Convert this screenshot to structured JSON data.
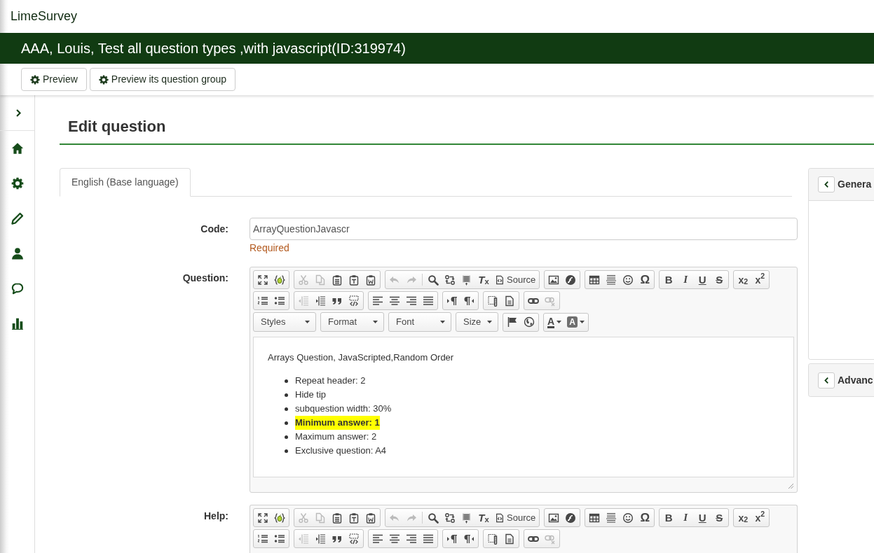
{
  "app": {
    "name": "LimeSurvey"
  },
  "survey": {
    "title": "AAA, Louis, Test all question types ,with javascript(ID:319974)"
  },
  "actions": [
    {
      "label": "Preview"
    },
    {
      "label": "Preview its question group"
    }
  ],
  "page": {
    "heading": "Edit question"
  },
  "language_tabs": [
    {
      "label": "English (Base language)",
      "selected": true
    }
  ],
  "fields": [
    {
      "kind": "text",
      "label": "Code:",
      "value": "ArrayQuestionJavascr",
      "note": "Required"
    },
    {
      "kind": "editor",
      "label": "Question:",
      "toolbar": [
        [
          [
            {
              "kind": "icon",
              "disabled": false
            },
            {
              "kind": "icon",
              "disabled": false
            }
          ],
          [
            {
              "kind": "icon",
              "disabled": true
            },
            {
              "kind": "icon",
              "disabled": true
            },
            {
              "kind": "icon",
              "disabled": false
            },
            {
              "kind": "icon",
              "disabled": false
            },
            {
              "kind": "icon",
              "disabled": false
            }
          ],
          [
            {
              "kind": "icon",
              "disabled": true
            },
            {
              "kind": "icon",
              "disabled": true
            },
            {
              "kind": "separator"
            },
            {
              "kind": "icon",
              "disabled": false
            },
            {
              "kind": "icon",
              "disabled": false
            },
            {
              "kind": "icon",
              "disabled": false
            },
            {
              "kind": "glyph",
              "label": "*T*$_{x}$",
              "disabled": false
            },
            {
              "kind": "labeled",
              "label": "Source",
              "disabled": false
            }
          ],
          [
            {
              "kind": "icon",
              "disabled": false
            },
            {
              "kind": "icon",
              "disabled": false
            }
          ],
          [
            {
              "kind": "icon",
              "disabled": false
            },
            {
              "kind": "icon",
              "disabled": false
            },
            {
              "kind": "icon",
              "disabled": false
            },
            {
              "kind": "glyph",
              "label": "Ω",
              "disabled": false
            }
          ],
          [
            {
              "kind": "bold",
              "label": "B",
              "disabled": false
            },
            {
              "kind": "italic",
              "label": "I",
              "disabled": false
            },
            {
              "kind": "underline",
              "label": "U",
              "disabled": false
            },
            {
              "kind": "strike",
              "label": "S",
              "disabled": false
            }
          ],
          [
            {
              "kind": "glyph",
              "label": "x$_{2}$",
              "disabled": false
            },
            {
              "kind": "glyph",
              "label": "x$^{2}$",
              "disabled": false
            }
          ]
        ],
        [
          [
            {
              "kind": "icon",
              "disabled": false
            },
            {
              "kind": "icon",
              "disabled": false
            }
          ],
          [
            {
              "kind": "icon",
              "disabled": true
            },
            {
              "kind": "icon",
              "disabled": false
            },
            {
              "kind": "icon",
              "disabled": false
            },
            {
              "kind": "icon",
              "disabled": false
            }
          ],
          [
            {
              "kind": "icon",
              "disabled": false
            },
            {
              "kind": "icon",
              "disabled": false
            },
            {
              "kind": "icon",
              "disabled": false
            },
            {
              "kind": "icon",
              "disabled": false
            }
          ],
          [
            {
              "kind": "icon",
              "disabled": false
            },
            {
              "kind": "icon",
              "disabled": false
            }
          ],
          [
            {
              "kind": "icon",
              "disabled": false
            },
            {
              "kind": "icon",
              "disabled": false
            }
          ],
          [
            {
              "kind": "icon",
              "disabled": false
            },
            {
              "kind": "icon",
              "disabled": true
            }
          ]
        ],
        [
          [
            {
              "kind": "combo",
              "label": "Styles"
            }
          ],
          [
            {
              "kind": "combo",
              "label": "Format"
            }
          ],
          [
            {
              "kind": "combo",
              "label": "Font"
            }
          ],
          [
            {
              "kind": "combo",
              "label": "Size"
            }
          ],
          [
            {
              "kind": "icon",
              "disabled": false
            },
            {
              "kind": "icon",
              "disabled": false
            }
          ],
          [
            {
              "kind": "text-color",
              "label": "A",
              "disabled": false
            },
            {
              "kind": "back-color",
              "label": "A",
              "disabled": false
            }
          ]
        ]
      ],
      "content": {
        "paragraph": "Arrays Question, JavaScripted,Random Order",
        "list": [
          {
            "text": "Repeat header: 2",
            "highlighted": false
          },
          {
            "text": "Hide tip",
            "highlighted": false
          },
          {
            "text": "subquestion width: 30%",
            "highlighted": false
          },
          {
            "text": "Minimum answer: 1",
            "highlighted": true
          },
          {
            "text": "Maximum answer: 2",
            "highlighted": false
          },
          {
            "text": "Exclusive question: A4",
            "highlighted": false
          }
        ]
      }
    },
    {
      "kind": "editor",
      "label": "Help:",
      "toolbar": [
        [
          [
            {
              "kind": "icon",
              "disabled": false
            },
            {
              "kind": "icon",
              "disabled": false
            }
          ],
          [
            {
              "kind": "icon",
              "disabled": true
            },
            {
              "kind": "icon",
              "disabled": true
            },
            {
              "kind": "icon",
              "disabled": false
            },
            {
              "kind": "icon",
              "disabled": false
            },
            {
              "kind": "icon",
              "disabled": false
            }
          ],
          [
            {
              "kind": "icon",
              "disabled": true
            },
            {
              "kind": "icon",
              "disabled": true
            },
            {
              "kind": "separator"
            },
            {
              "kind": "icon",
              "disabled": false
            },
            {
              "kind": "icon",
              "disabled": false
            },
            {
              "kind": "icon",
              "disabled": false
            },
            {
              "kind": "glyph",
              "label": "*T*$_{x}$",
              "disabled": false
            },
            {
              "kind": "labeled",
              "label": "Source",
              "disabled": false
            }
          ],
          [
            {
              "kind": "icon",
              "disabled": false
            },
            {
              "kind": "icon",
              "disabled": false
            }
          ],
          [
            {
              "kind": "icon",
              "disabled": false
            },
            {
              "kind": "icon",
              "disabled": false
            },
            {
              "kind": "icon",
              "disabled": false
            },
            {
              "kind": "glyph",
              "label": "Ω",
              "disabled": false
            }
          ],
          [
            {
              "kind": "bold",
              "label": "B",
              "disabled": false
            },
            {
              "kind": "italic",
              "label": "I",
              "disabled": false
            },
            {
              "kind": "underline",
              "label": "U",
              "disabled": false
            },
            {
              "kind": "strike",
              "label": "S",
              "disabled": false
            }
          ],
          [
            {
              "kind": "glyph",
              "label": "x$_{2}$",
              "disabled": false
            },
            {
              "kind": "glyph",
              "label": "x$^{2}$",
              "disabled": false
            }
          ]
        ],
        [
          [
            {
              "kind": "icon",
              "disabled": false
            },
            {
              "kind": "icon",
              "disabled": false
            }
          ],
          [
            {
              "kind": "icon",
              "disabled": true
            },
            {
              "kind": "icon",
              "disabled": false
            },
            {
              "kind": "icon",
              "disabled": false
            },
            {
              "kind": "icon",
              "disabled": false
            }
          ],
          [
            {
              "kind": "icon",
              "disabled": false
            },
            {
              "kind": "icon",
              "disabled": false
            },
            {
              "kind": "icon",
              "disabled": false
            },
            {
              "kind": "icon",
              "disabled": false
            }
          ],
          [
            {
              "kind": "icon",
              "disabled": false
            },
            {
              "kind": "icon",
              "disabled": false
            }
          ],
          [
            {
              "kind": "icon",
              "disabled": false
            },
            {
              "kind": "icon",
              "disabled": false
            }
          ],
          [
            {
              "kind": "icon",
              "disabled": false
            },
            {
              "kind": "icon",
              "disabled": true
            }
          ]
        ]
      ]
    }
  ],
  "side_panels": [
    {
      "title": "Genera",
      "expanded": true
    },
    {
      "title": "Advanc",
      "expanded": false
    }
  ]
}
